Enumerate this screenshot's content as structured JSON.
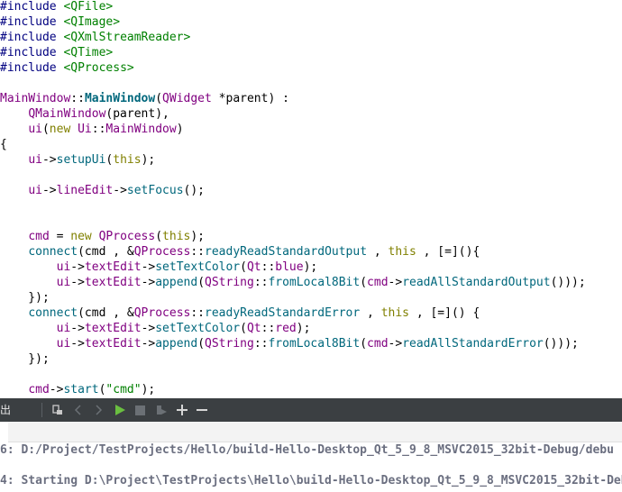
{
  "editor": {
    "lines": [
      [
        {
          "t": "#include ",
          "c": "pp"
        },
        {
          "t": "<QFile>",
          "c": "inc"
        }
      ],
      [
        {
          "t": "#include ",
          "c": "pp"
        },
        {
          "t": "<QImage>",
          "c": "inc"
        }
      ],
      [
        {
          "t": "#include ",
          "c": "pp"
        },
        {
          "t": "<QXmlStreamReader>",
          "c": "inc"
        }
      ],
      [
        {
          "t": "#include ",
          "c": "pp"
        },
        {
          "t": "<QTime>",
          "c": "inc"
        }
      ],
      [
        {
          "t": "#include ",
          "c": "pp"
        },
        {
          "t": "<QProcess>",
          "c": "inc"
        }
      ],
      [],
      [
        {
          "t": "MainWindow",
          "c": "type"
        },
        {
          "t": "::",
          "c": "plain"
        },
        {
          "t": "MainWindow",
          "c": "fnb"
        },
        {
          "t": "(",
          "c": "plain"
        },
        {
          "t": "QWidget",
          "c": "type"
        },
        {
          "t": " *parent) :",
          "c": "plain"
        }
      ],
      [
        {
          "t": "    ",
          "c": "plain"
        },
        {
          "t": "QMainWindow",
          "c": "type"
        },
        {
          "t": "(parent),",
          "c": "plain"
        }
      ],
      [
        {
          "t": "    ",
          "c": "plain"
        },
        {
          "t": "ui",
          "c": "type"
        },
        {
          "t": "(",
          "c": "plain"
        },
        {
          "t": "new",
          "c": "kw"
        },
        {
          "t": " ",
          "c": "plain"
        },
        {
          "t": "Ui",
          "c": "type"
        },
        {
          "t": "::",
          "c": "plain"
        },
        {
          "t": "MainWindow",
          "c": "type"
        },
        {
          "t": ")",
          "c": "plain"
        }
      ],
      [
        {
          "t": "{",
          "c": "plain"
        }
      ],
      [
        {
          "t": "    ",
          "c": "plain"
        },
        {
          "t": "ui",
          "c": "type"
        },
        {
          "t": "->",
          "c": "plain"
        },
        {
          "t": "setupUi",
          "c": "fn"
        },
        {
          "t": "(",
          "c": "plain"
        },
        {
          "t": "this",
          "c": "kw"
        },
        {
          "t": ");",
          "c": "plain"
        }
      ],
      [],
      [
        {
          "t": "    ",
          "c": "plain"
        },
        {
          "t": "ui",
          "c": "type"
        },
        {
          "t": "->",
          "c": "plain"
        },
        {
          "t": "lineEdit",
          "c": "type"
        },
        {
          "t": "->",
          "c": "plain"
        },
        {
          "t": "setFocus",
          "c": "fn"
        },
        {
          "t": "();",
          "c": "plain"
        }
      ],
      [],
      [],
      [
        {
          "t": "    ",
          "c": "plain"
        },
        {
          "t": "cmd",
          "c": "type"
        },
        {
          "t": " = ",
          "c": "plain"
        },
        {
          "t": "new",
          "c": "kw"
        },
        {
          "t": " ",
          "c": "plain"
        },
        {
          "t": "QProcess",
          "c": "type"
        },
        {
          "t": "(",
          "c": "plain"
        },
        {
          "t": "this",
          "c": "kw"
        },
        {
          "t": ");",
          "c": "plain"
        }
      ],
      [
        {
          "t": "    ",
          "c": "plain"
        },
        {
          "t": "connect",
          "c": "fn"
        },
        {
          "t": "(cmd , &",
          "c": "plain"
        },
        {
          "t": "QProcess",
          "c": "type"
        },
        {
          "t": "::",
          "c": "plain"
        },
        {
          "t": "readyReadStandardOutput",
          "c": "fn"
        },
        {
          "t": " , ",
          "c": "plain"
        },
        {
          "t": "this",
          "c": "kw"
        },
        {
          "t": " , [=](){",
          "c": "plain"
        }
      ],
      [
        {
          "t": "        ",
          "c": "plain"
        },
        {
          "t": "ui",
          "c": "type"
        },
        {
          "t": "->",
          "c": "plain"
        },
        {
          "t": "textEdit",
          "c": "type"
        },
        {
          "t": "->",
          "c": "plain"
        },
        {
          "t": "setTextColor",
          "c": "fn"
        },
        {
          "t": "(",
          "c": "plain"
        },
        {
          "t": "Qt",
          "c": "type"
        },
        {
          "t": "::",
          "c": "plain"
        },
        {
          "t": "blue",
          "c": "type"
        },
        {
          "t": ");",
          "c": "plain"
        }
      ],
      [
        {
          "t": "        ",
          "c": "plain"
        },
        {
          "t": "ui",
          "c": "type"
        },
        {
          "t": "->",
          "c": "plain"
        },
        {
          "t": "textEdit",
          "c": "type"
        },
        {
          "t": "->",
          "c": "plain"
        },
        {
          "t": "append",
          "c": "fn"
        },
        {
          "t": "(",
          "c": "plain"
        },
        {
          "t": "QString",
          "c": "type"
        },
        {
          "t": "::",
          "c": "plain"
        },
        {
          "t": "fromLocal8Bit",
          "c": "fn"
        },
        {
          "t": "(",
          "c": "plain"
        },
        {
          "t": "cmd",
          "c": "type"
        },
        {
          "t": "->",
          "c": "plain"
        },
        {
          "t": "readAllStandardOutput",
          "c": "fn"
        },
        {
          "t": "()));",
          "c": "plain"
        }
      ],
      [
        {
          "t": "    });",
          "c": "plain"
        }
      ],
      [
        {
          "t": "    ",
          "c": "plain"
        },
        {
          "t": "connect",
          "c": "fn"
        },
        {
          "t": "(cmd , &",
          "c": "plain"
        },
        {
          "t": "QProcess",
          "c": "type"
        },
        {
          "t": "::",
          "c": "plain"
        },
        {
          "t": "readyReadStandardError",
          "c": "fn"
        },
        {
          "t": " , ",
          "c": "plain"
        },
        {
          "t": "this",
          "c": "kw"
        },
        {
          "t": " , [=]() {",
          "c": "plain"
        }
      ],
      [
        {
          "t": "        ",
          "c": "plain"
        },
        {
          "t": "ui",
          "c": "type"
        },
        {
          "t": "->",
          "c": "plain"
        },
        {
          "t": "textEdit",
          "c": "type"
        },
        {
          "t": "->",
          "c": "plain"
        },
        {
          "t": "setTextColor",
          "c": "fn"
        },
        {
          "t": "(",
          "c": "plain"
        },
        {
          "t": "Qt",
          "c": "type"
        },
        {
          "t": "::",
          "c": "plain"
        },
        {
          "t": "red",
          "c": "type"
        },
        {
          "t": ");",
          "c": "plain"
        }
      ],
      [
        {
          "t": "        ",
          "c": "plain"
        },
        {
          "t": "ui",
          "c": "type"
        },
        {
          "t": "->",
          "c": "plain"
        },
        {
          "t": "textEdit",
          "c": "type"
        },
        {
          "t": "->",
          "c": "plain"
        },
        {
          "t": "append",
          "c": "fn"
        },
        {
          "t": "(",
          "c": "plain"
        },
        {
          "t": "QString",
          "c": "type"
        },
        {
          "t": "::",
          "c": "plain"
        },
        {
          "t": "fromLocal8Bit",
          "c": "fn"
        },
        {
          "t": "(",
          "c": "plain"
        },
        {
          "t": "cmd",
          "c": "type"
        },
        {
          "t": "->",
          "c": "plain"
        },
        {
          "t": "readAllStandardError",
          "c": "fn"
        },
        {
          "t": "()));",
          "c": "plain"
        }
      ],
      [
        {
          "t": "    });",
          "c": "plain"
        }
      ],
      [],
      [
        {
          "t": "    ",
          "c": "plain"
        },
        {
          "t": "cmd",
          "c": "type"
        },
        {
          "t": "->",
          "c": "plain"
        },
        {
          "t": "start",
          "c": "fn"
        },
        {
          "t": "(",
          "c": "plain"
        },
        {
          "t": "\"cmd\"",
          "c": "str"
        },
        {
          "t": ");",
          "c": "plain"
        }
      ]
    ]
  },
  "output": {
    "title": "出",
    "toolbar_icons": [
      "attach-icon",
      "prev-arrow-icon",
      "next-arrow-icon",
      "run-icon",
      "stop-icon",
      "debug-icon",
      "plus-icon",
      "minus-icon"
    ],
    "lines": [
      "6: D:/Project/TestProjects/Hello/build-Hello-Desktop_Qt_5_9_8_MSVC2015_32bit-Debug/debu",
      "4: Starting D:\\Project\\TestProjects\\Hello\\build-Hello-Desktop_Qt_5_9_8_MSVC2015_32bit-Deb"
    ]
  },
  "colors": {
    "keyword": "#808000",
    "type": "#800080",
    "function": "#00677c",
    "string": "#008000",
    "preprocessor": "#000080",
    "toolbar_bg": "#3b3f42",
    "run_green": "#6abf40"
  }
}
